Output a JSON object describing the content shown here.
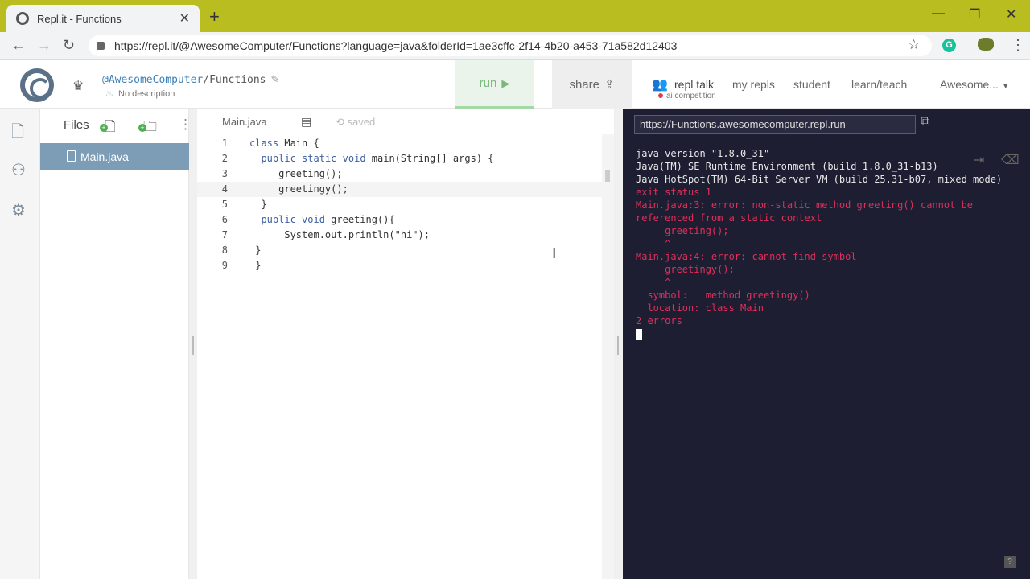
{
  "browser": {
    "tab_title": "Repl.it - Functions",
    "url": "https://repl.it/@AwesomeComputer/Functions?language=java&folderId=1ae3cffc-2f14-4b20-a453-71a582d12403"
  },
  "header": {
    "user": "@AwesomeComputer",
    "project_sep": "/",
    "project": "Functions",
    "description": "No description",
    "run_label": "run",
    "share_label": "share",
    "nav": {
      "repl_talk": "repl talk",
      "repl_talk_sub": "ai competition",
      "my_repls": "my repls",
      "student": "student",
      "learn_teach": "learn/teach",
      "account": "Awesome..."
    }
  },
  "files": {
    "header": "Files",
    "items": [
      "Main.java"
    ]
  },
  "editor": {
    "tab": "Main.java",
    "status": "saved",
    "lines": [
      {
        "n": "1",
        "text": "class Main {"
      },
      {
        "n": "2",
        "text": "  public static void main(String[] args) {"
      },
      {
        "n": "3",
        "text": "     greeting();"
      },
      {
        "n": "4",
        "text": "     greetingy();"
      },
      {
        "n": "5",
        "text": "  }"
      },
      {
        "n": "6",
        "text": "  public void greeting(){"
      },
      {
        "n": "7",
        "text": "      System.out.println(\"hi\");"
      },
      {
        "n": "8",
        "text": " }"
      },
      {
        "n": "9",
        "text": " }"
      }
    ],
    "active_line": 4
  },
  "console": {
    "url": "https://Functions.awesomecomputer.repl.run",
    "output": [
      {
        "text": "java version \"1.8.0_31\"",
        "type": "normal"
      },
      {
        "text": "Java(TM) SE Runtime Environment (build 1.8.0_31-b13)",
        "type": "normal"
      },
      {
        "text": "Java HotSpot(TM) 64-Bit Server VM (build 25.31-b07, mixed mode)",
        "type": "normal"
      },
      {
        "text": "exit status 1",
        "type": "error"
      },
      {
        "text": "Main.java:3: error: non-static method greeting() cannot be referenced from a static context",
        "type": "error"
      },
      {
        "text": "     greeting();",
        "type": "error"
      },
      {
        "text": "     ^",
        "type": "error"
      },
      {
        "text": "Main.java:4: error: cannot find symbol",
        "type": "error"
      },
      {
        "text": "     greetingy();",
        "type": "error"
      },
      {
        "text": "     ^",
        "type": "error"
      },
      {
        "text": "  symbol:   method greetingy()",
        "type": "error"
      },
      {
        "text": "  location: class Main",
        "type": "error"
      },
      {
        "text": "2 errors",
        "type": "error"
      }
    ]
  },
  "colors": {
    "tabbar": "#b9bd1f",
    "console_bg": "#1e1e32",
    "error_text": "#e02f5a",
    "file_selected": "#7d9cb5"
  }
}
